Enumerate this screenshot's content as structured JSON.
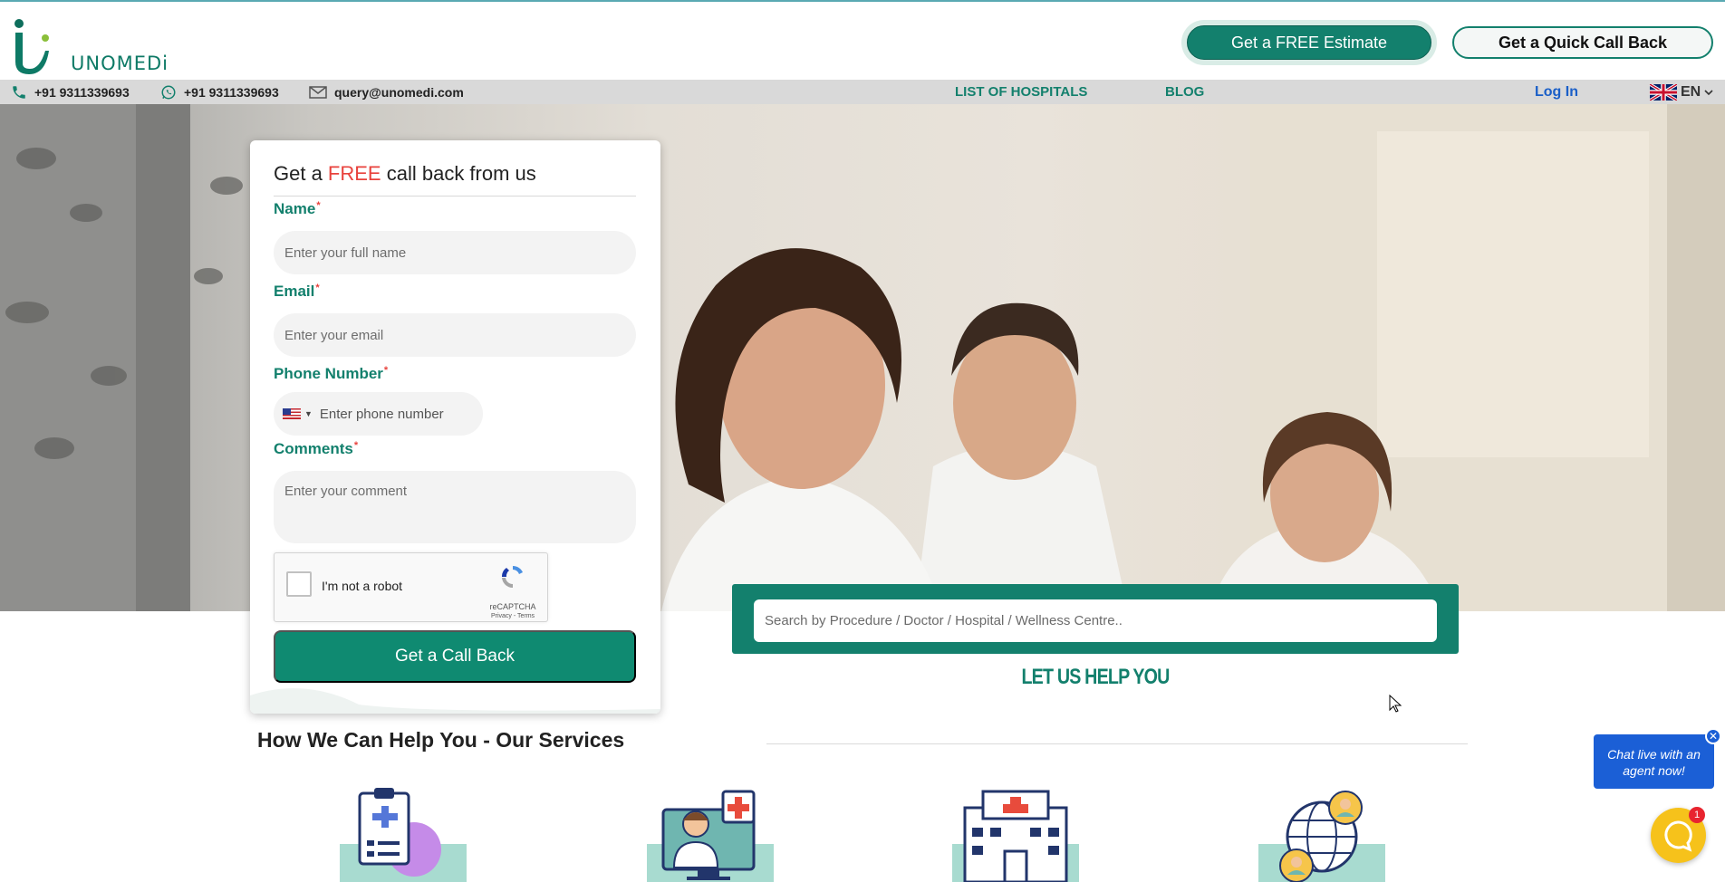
{
  "brand": {
    "name": "UNOMEDi"
  },
  "header": {
    "estimate_label": "Get a FREE Estimate",
    "callback_label": "Get a Quick Call Back"
  },
  "infobar": {
    "phone": "+91 9311339693",
    "whatsapp": "+91 9311339693",
    "email": "query@unomedi.com",
    "nav": [
      "LIST OF HOSPITALS",
      "BLOG"
    ],
    "login": "Log In",
    "language": "EN"
  },
  "form": {
    "title_pre": "Get a ",
    "title_free": "FREE",
    "title_post": " call back from us",
    "name_label": "Name",
    "name_placeholder": "Enter your full name",
    "email_label": "Email",
    "email_placeholder": "Enter your email",
    "phone_label": "Phone Number",
    "phone_placeholder": "Enter phone number",
    "comments_label": "Comments",
    "comments_placeholder": "Enter your comment",
    "required_mark": "*",
    "recaptcha_text": "I'm not a robot",
    "recaptcha_brand": "reCAPTCHA",
    "recaptcha_links": "Privacy - Terms",
    "submit_label": "Get a Call Back"
  },
  "search": {
    "placeholder": "Search by Procedure / Doctor / Hospital / Wellness Centre.."
  },
  "help_heading": "LET US HELP YOU",
  "services": {
    "title": "How We Can Help You - Our Services"
  },
  "chat": {
    "bubble_text": "Chat live with an agent now!",
    "badge_count": "1"
  },
  "colors": {
    "brand_green": "#13806d",
    "accent_red": "#e8423c",
    "link_blue": "#1a5fc8",
    "chat_yellow": "#f6c21b"
  }
}
